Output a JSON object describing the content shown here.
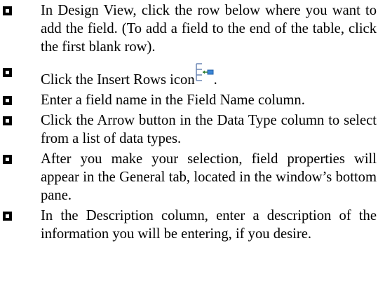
{
  "steps": [
    {
      "text": "In Design View, click the row below where you want to add the field.  (To add a field to the end of the table, click the first blank row)."
    },
    {
      "text_before": "Click the Insert Rows icon",
      "icon": "insert-rows-icon",
      "text_after": "."
    },
    {
      "text": "Enter a field name in the Field Name column."
    },
    {
      "text": "Click the Arrow button in the Data Type column to select from a list of data types."
    },
    {
      "text": "After you make your selection, field properties will appear in the General tab, located in the window’s bottom pane."
    },
    {
      "text": "In the Description column, enter a description of the information you will be entering, if you desire."
    }
  ]
}
